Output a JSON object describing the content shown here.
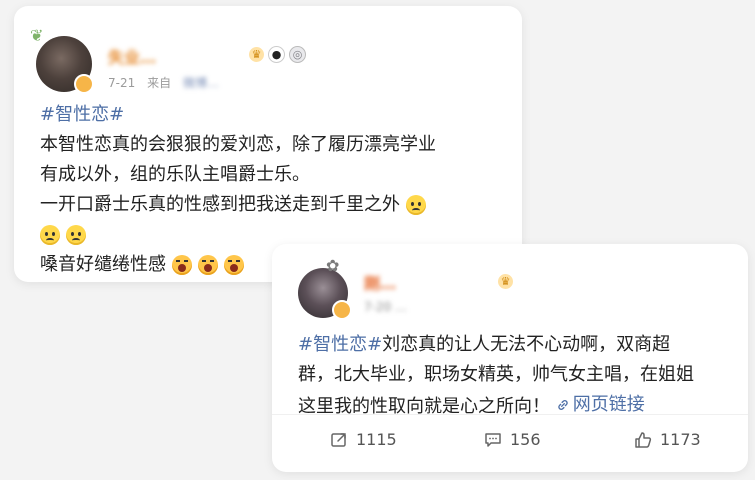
{
  "post1": {
    "username": "失业…",
    "date": "7-21",
    "source_prefix": "来自",
    "source_app": "微博…",
    "hashtag": "#智性恋#",
    "line1": "本智性恋真的会狠狠的爱刘恋，除了履历漂亮学业",
    "line2": "有成以外，组的乐队主唱爵士乐。",
    "line3": "一开口爵士乐真的性感到把我送走到千里之外",
    "line4": "嗓音好缱绻性感",
    "badges": [
      "crown-badge",
      "panda-badge",
      "medal-badge"
    ]
  },
  "post2": {
    "username": "刚…",
    "meta": "7-20 …",
    "hashtag": "#智性恋#",
    "text_a": "刘恋真的让人无法不心动啊，双商超",
    "text_b": "群，北大毕业，职场女精英，帅气女主唱，在姐姐",
    "text_c": "这里我的性取向就是心之所向！",
    "link_label": "网页链接",
    "actions": {
      "repost_count": "1115",
      "comment_count": "156",
      "like_count": "1173"
    }
  },
  "colors": {
    "hashtag": "#4e6fa6",
    "background": "#f3f3f3",
    "card": "#ffffff"
  }
}
